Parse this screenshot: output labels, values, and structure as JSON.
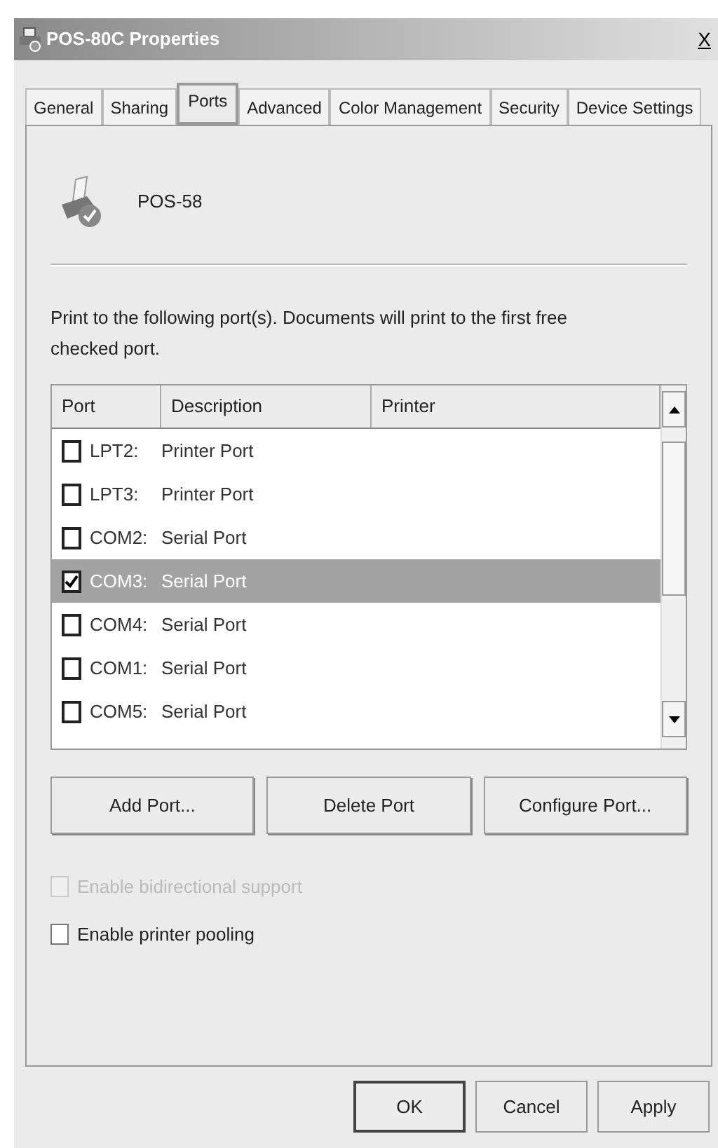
{
  "window": {
    "title": "POS-80C Properties",
    "close": "X"
  },
  "tabs": [
    {
      "label": "General",
      "selected": false
    },
    {
      "label": "Sharing",
      "selected": false
    },
    {
      "label": "Ports",
      "selected": true
    },
    {
      "label": "Advanced",
      "selected": false
    },
    {
      "label": "Color Management",
      "selected": false
    },
    {
      "label": "Security",
      "selected": false
    },
    {
      "label": "Device Settings",
      "selected": false
    }
  ],
  "printer_name": "POS-58",
  "instructions": "Print to the following port(s). Documents will print to the first free checked port.",
  "ports_table": {
    "columns": [
      "Port",
      "Description",
      "Printer"
    ],
    "rows": [
      {
        "port": "LPT2:",
        "description": "Printer Port",
        "checked": false,
        "selected": false
      },
      {
        "port": "LPT3:",
        "description": "Printer Port",
        "checked": false,
        "selected": false
      },
      {
        "port": "COM2:",
        "description": "Serial Port",
        "checked": false,
        "selected": false
      },
      {
        "port": "COM3:",
        "description": "Serial Port",
        "checked": true,
        "selected": true
      },
      {
        "port": "COM4:",
        "description": "Serial Port",
        "checked": false,
        "selected": false
      },
      {
        "port": "COM1:",
        "description": "Serial Port",
        "checked": false,
        "selected": false
      },
      {
        "port": "COM5:",
        "description": "Serial Port",
        "checked": false,
        "selected": false
      }
    ]
  },
  "port_buttons": [
    "Add Port...",
    "Delete Port",
    "Configure Port..."
  ],
  "options": [
    {
      "label": "Enable bidirectional support",
      "checked": false,
      "disabled": true
    },
    {
      "label": "Enable printer pooling",
      "checked": false,
      "disabled": false
    }
  ],
  "dialog_buttons": [
    {
      "label": "OK",
      "default": true
    },
    {
      "label": "Cancel",
      "default": false
    },
    {
      "label": "Apply",
      "default": false
    }
  ]
}
